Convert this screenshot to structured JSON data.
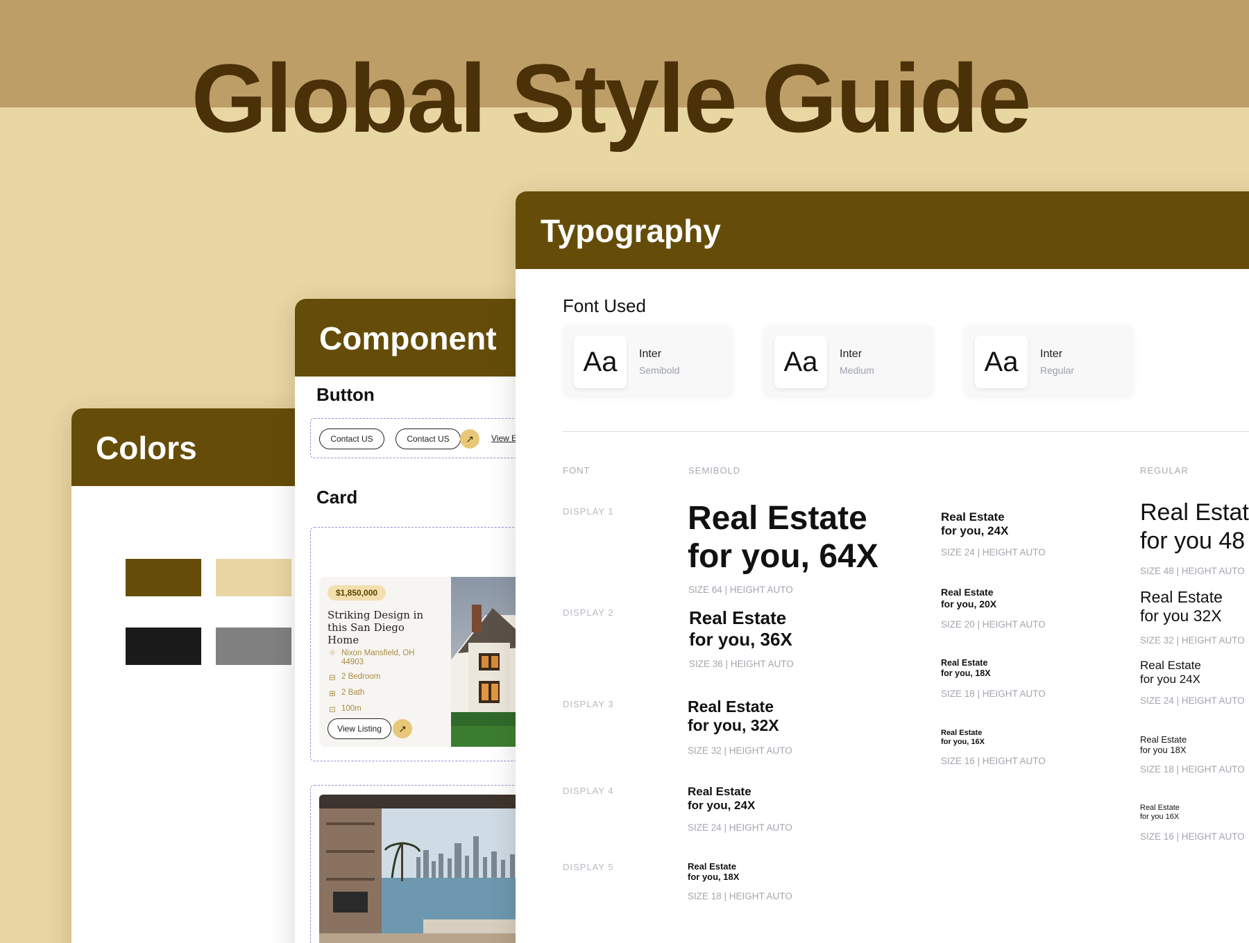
{
  "title": "Global Style Guide",
  "colors_panel": {
    "heading": "Colors",
    "swatches": [
      "#654d09",
      "#e8d6a3",
      "#1a1a1a",
      "#808080"
    ]
  },
  "component_panel": {
    "heading": "Component",
    "button_section": "Button",
    "buttons": {
      "contact_us_1": "Contact US",
      "contact_us_2": "Contact US",
      "view_link": "View E"
    },
    "card_section": "Card",
    "card": {
      "price": "$1,850,000",
      "title": "Striking Design in this San Diego Home",
      "address": "Nixon Mansfield, OH 44903",
      "bedrooms": "2 Bedroom",
      "baths": "2 Bath",
      "area": "100m",
      "cta": "View Listing"
    },
    "icons": {
      "arrow": "arrow-up-right-icon",
      "location": "location-pin-icon",
      "bed": "bed-icon",
      "bath": "bath-icon",
      "area": "area-icon"
    }
  },
  "typography_panel": {
    "heading": "Typography",
    "font_used_label": "Font Used",
    "fonts": [
      {
        "sample": "Aa",
        "name": "Inter",
        "weight": "Semibold"
      },
      {
        "sample": "Aa",
        "name": "Inter",
        "weight": "Medium"
      },
      {
        "sample": "Aa",
        "name": "Inter",
        "weight": "Regular"
      }
    ],
    "columns": {
      "font": "FONT",
      "semibold": "SEMIBOLD",
      "regular": "REGULAR"
    },
    "rows": [
      "DISPLAY 1",
      "DISPLAY 2",
      "DISPLAY 3",
      "DISPLAY 4",
      "DISPLAY 5"
    ],
    "semibold_big": [
      {
        "l1": "Real Estate",
        "l2": "for you, 64X",
        "size": "SIZE 64 | HEIGHT AUTO"
      },
      {
        "l1": "Real Estate",
        "l2": "for you, 36X",
        "size": "SIZE 36 | HEIGHT AUTO"
      },
      {
        "l1": "Real Estate",
        "l2": "for you, 32X",
        "size": "SIZE 32 | HEIGHT AUTO"
      },
      {
        "l1": "Real Estate",
        "l2": "for you, 24X",
        "size": "SIZE 24 | HEIGHT AUTO"
      },
      {
        "l1": "Real Estate",
        "l2": "for you, 18X",
        "size": "SIZE 18 | HEIGHT AUTO"
      }
    ],
    "semibold_small": [
      {
        "l1": "Real Estate",
        "l2": "for you, 24X",
        "size": "SIZE 24 | HEIGHT AUTO"
      },
      {
        "l1": "Real Estate",
        "l2": "for you, 20X",
        "size": "SIZE 20 | HEIGHT AUTO"
      },
      {
        "l1": "Real Estate",
        "l2": "for you, 18X",
        "size": "SIZE 18 | HEIGHT AUTO"
      },
      {
        "l1": "Real Estate",
        "l2": "for you, 16X",
        "size": "SIZE 16 | HEIGHT AUTO"
      }
    ],
    "regular": [
      {
        "l1": "Real Estat",
        "l2": "for you 48",
        "size": "SIZE 48 | HEIGHT AUTO"
      },
      {
        "l1": "Real Estate",
        "l2": "for you 32X",
        "size": "SIZE 32 | HEIGHT AUTO"
      },
      {
        "l1": "Real Estate",
        "l2": "for you 24X",
        "size": "SIZE 24 | HEIGHT AUTO"
      },
      {
        "l1": "Real Estate",
        "l2": "for you 18X",
        "size": "SIZE 18 | HEIGHT AUTO"
      },
      {
        "l1": "Real Estate",
        "l2": "for you 16X",
        "size": "SIZE 16 | HEIGHT AUTO"
      }
    ]
  }
}
